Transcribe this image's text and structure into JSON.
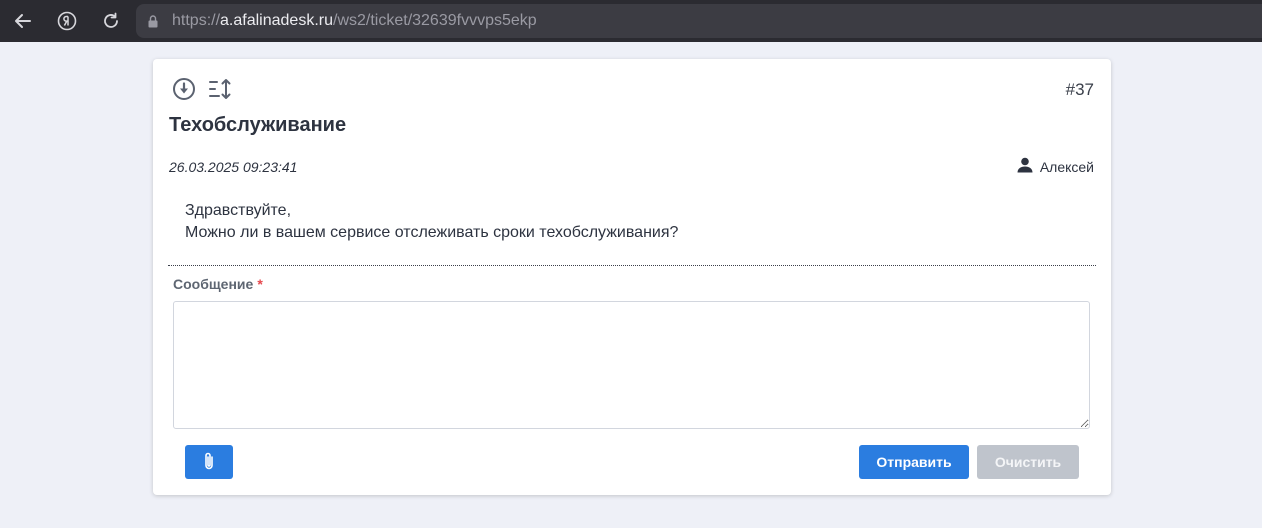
{
  "browser": {
    "url_scheme": "https://",
    "url_host": "a.afalinadesk.ru",
    "url_path": "/ws2/ticket/32639fvvvps5ekp"
  },
  "ticket": {
    "number": "#37",
    "title": "Техобслуживание",
    "date": "26.03.2025 09:23:41",
    "author": "Алексей",
    "body_line1": "Здравствуйте,",
    "body_line2": "Можно ли в вашем сервисе отслеживать сроки техобслуживания?"
  },
  "reply": {
    "label": "Сообщение",
    "required_mark": "*",
    "value": "",
    "send_label": "Отправить",
    "clear_label": "Очистить"
  },
  "colors": {
    "primary": "#2b7de0",
    "disabled": "#bfc4cc",
    "required": "#e5484d"
  }
}
